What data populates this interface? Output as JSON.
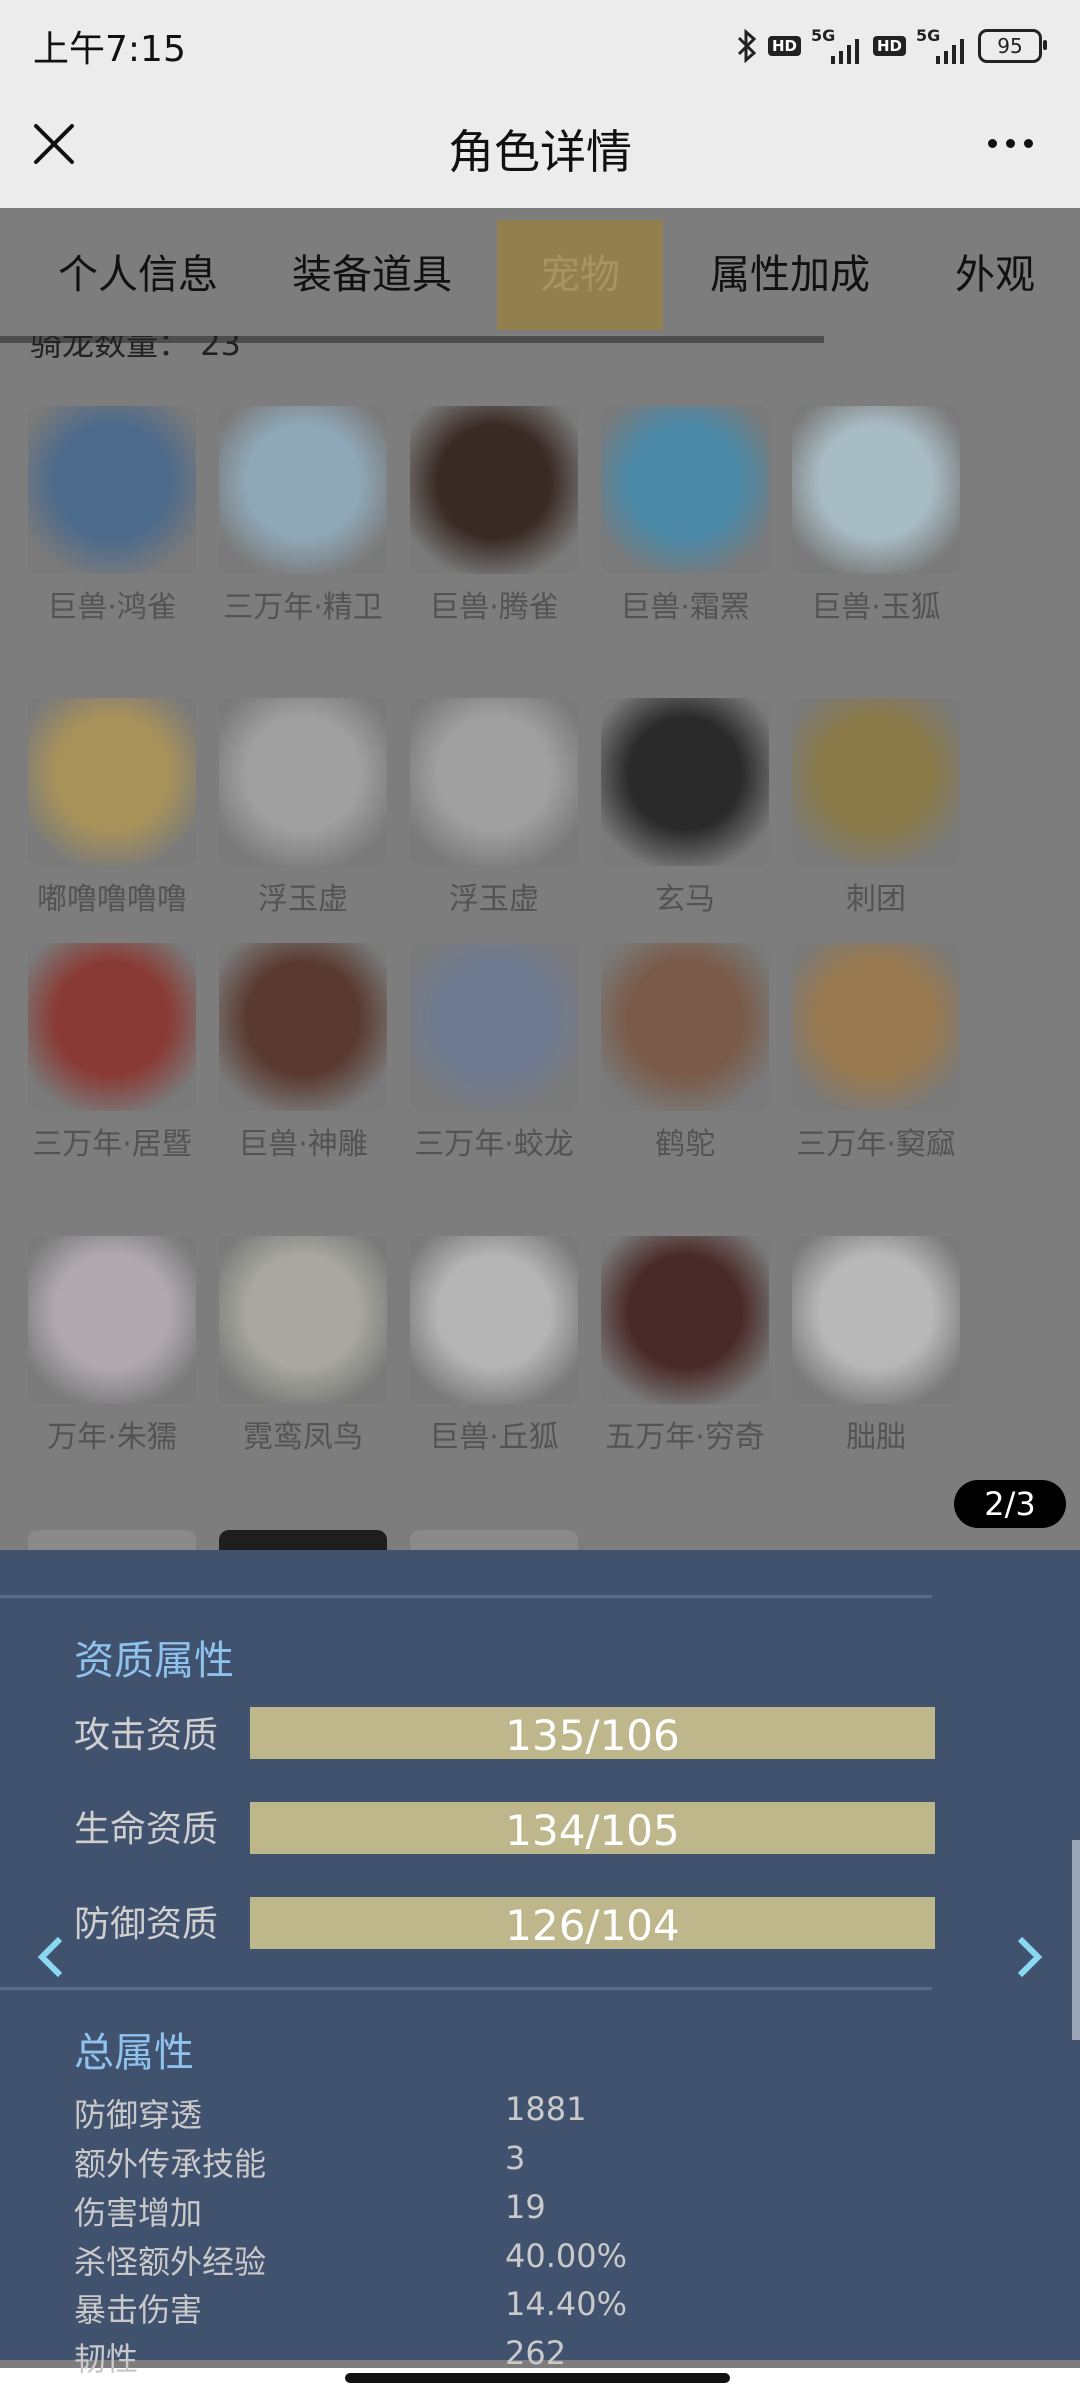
{
  "status_bar": {
    "time": "上午7:15",
    "hd_label": "HD",
    "network_label": "5G",
    "battery": "95"
  },
  "title_bar": {
    "title": "角色详情",
    "close_icon": "close-icon",
    "more_icon": "more-horizontal-icon"
  },
  "tabs": [
    {
      "label": "个人信息",
      "active": false
    },
    {
      "label": "装备道具",
      "active": false
    },
    {
      "label": "宠物",
      "active": true
    },
    {
      "label": "属性加成",
      "active": false
    },
    {
      "label": "外观",
      "active": false
    }
  ],
  "mount_count": {
    "label": "骑龙数量：",
    "value": "23"
  },
  "pets": [
    {
      "name": "巨兽·鸿雀",
      "color": "#4c6a8c"
    },
    {
      "name": "三万年·精卫",
      "color": "#8fa8b8"
    },
    {
      "name": "巨兽·腾雀",
      "color": "#3a2a24"
    },
    {
      "name": "巨兽·霜罴",
      "color": "#4d8aa8"
    },
    {
      "name": "巨兽·玉狐",
      "color": "#a8bcc4"
    },
    {
      "name": "嘟噜噜噜噜",
      "color": "#a8925a"
    },
    {
      "name": "浮玉虚",
      "color": "#a0a0a0"
    },
    {
      "name": "浮玉虚",
      "color": "#a0a0a0"
    },
    {
      "name": "玄马",
      "color": "#2a2a2a"
    },
    {
      "name": "刺团",
      "color": "#8a7a4a"
    },
    {
      "name": "三万年·居暨",
      "color": "#8a3a34"
    },
    {
      "name": "巨兽·神雕",
      "color": "#5a3a30"
    },
    {
      "name": "三万年·蛟龙",
      "color": "#6f7a90"
    },
    {
      "name": "鹤鸵",
      "color": "#7a5a48"
    },
    {
      "name": "三万年·窫窳",
      "color": "#9a7a50"
    },
    {
      "name": "万年·朱獳",
      "color": "#b0aab0"
    },
    {
      "name": "霓鸾凤鸟",
      "color": "#a8a8a0"
    },
    {
      "name": "巨兽·丘狐",
      "color": "#b4b4b4"
    },
    {
      "name": "五万年·穷奇",
      "color": "#4a2a28"
    },
    {
      "name": "朏朏",
      "color": "#b8b8b8"
    }
  ],
  "pagination": {
    "label": "2/3"
  },
  "aptitude": {
    "title": "资质属性",
    "items": [
      {
        "label": "攻击资质",
        "value": "135/106"
      },
      {
        "label": "生命资质",
        "value": "134/105"
      },
      {
        "label": "防御资质",
        "value": "126/104"
      }
    ]
  },
  "total": {
    "title": "总属性",
    "items": [
      {
        "name": "防御穿透",
        "value": "1881"
      },
      {
        "name": "额外传承技能",
        "value": "3"
      },
      {
        "name": "伤害增加",
        "value": "19"
      },
      {
        "name": "杀怪额外经验",
        "value": "40.00%"
      },
      {
        "name": "暴击伤害",
        "value": "14.40%"
      },
      {
        "name": "韧性",
        "value": "262"
      }
    ]
  }
}
